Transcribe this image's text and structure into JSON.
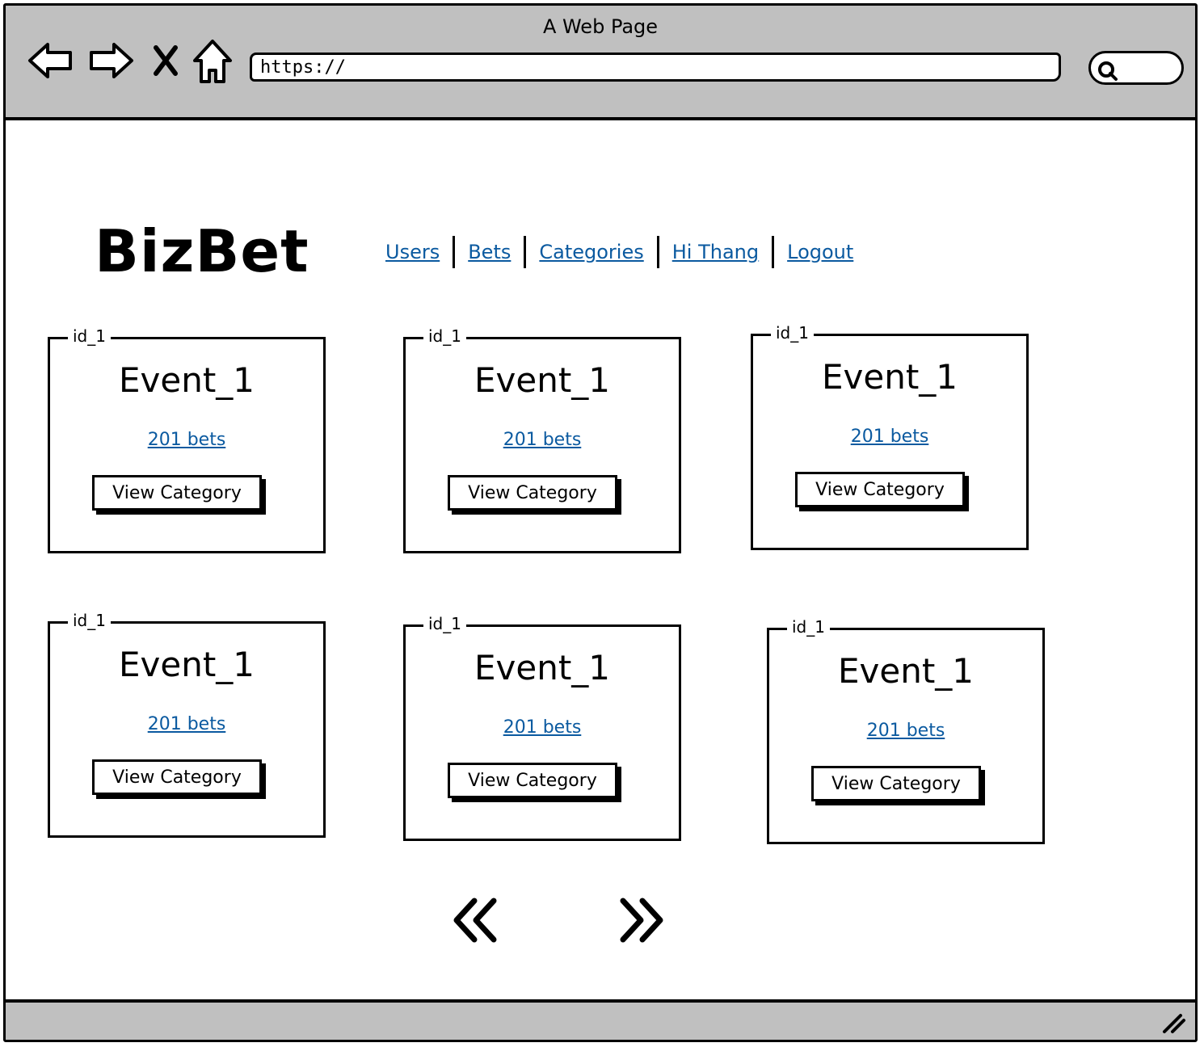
{
  "window": {
    "title": "A Web Page",
    "url": "https://"
  },
  "header": {
    "logo": "BizBet",
    "nav": [
      {
        "label": "Users"
      },
      {
        "label": "Bets"
      },
      {
        "label": "Categories"
      },
      {
        "label": "Hi Thang"
      },
      {
        "label": "Logout"
      }
    ]
  },
  "cards": [
    {
      "id": "id_1",
      "title": "Event_1",
      "bets": "201 bets",
      "button": "View Category"
    },
    {
      "id": "id_1",
      "title": "Event_1",
      "bets": "201 bets",
      "button": "View Category"
    },
    {
      "id": "id_1",
      "title": "Event_1",
      "bets": "201 bets",
      "button": "View Category"
    },
    {
      "id": "id_1",
      "title": "Event_1",
      "bets": "201 bets",
      "button": "View Category"
    },
    {
      "id": "id_1",
      "title": "Event_1",
      "bets": "201 bets",
      "button": "View Category"
    },
    {
      "id": "id_1",
      "title": "Event_1",
      "bets": "201 bets",
      "button": "View Category"
    }
  ],
  "pagination": {
    "prev_icon": "double-chevron-left-icon",
    "next_icon": "double-chevron-right-icon"
  },
  "icons": {
    "back": "back-arrow-icon",
    "forward": "forward-arrow-icon",
    "stop": "close-icon",
    "home": "home-icon",
    "search": "search-icon",
    "resize": "resize-grip-icon"
  },
  "colors": {
    "chrome": "#c0c0c0",
    "link": "#0b5aa0"
  }
}
